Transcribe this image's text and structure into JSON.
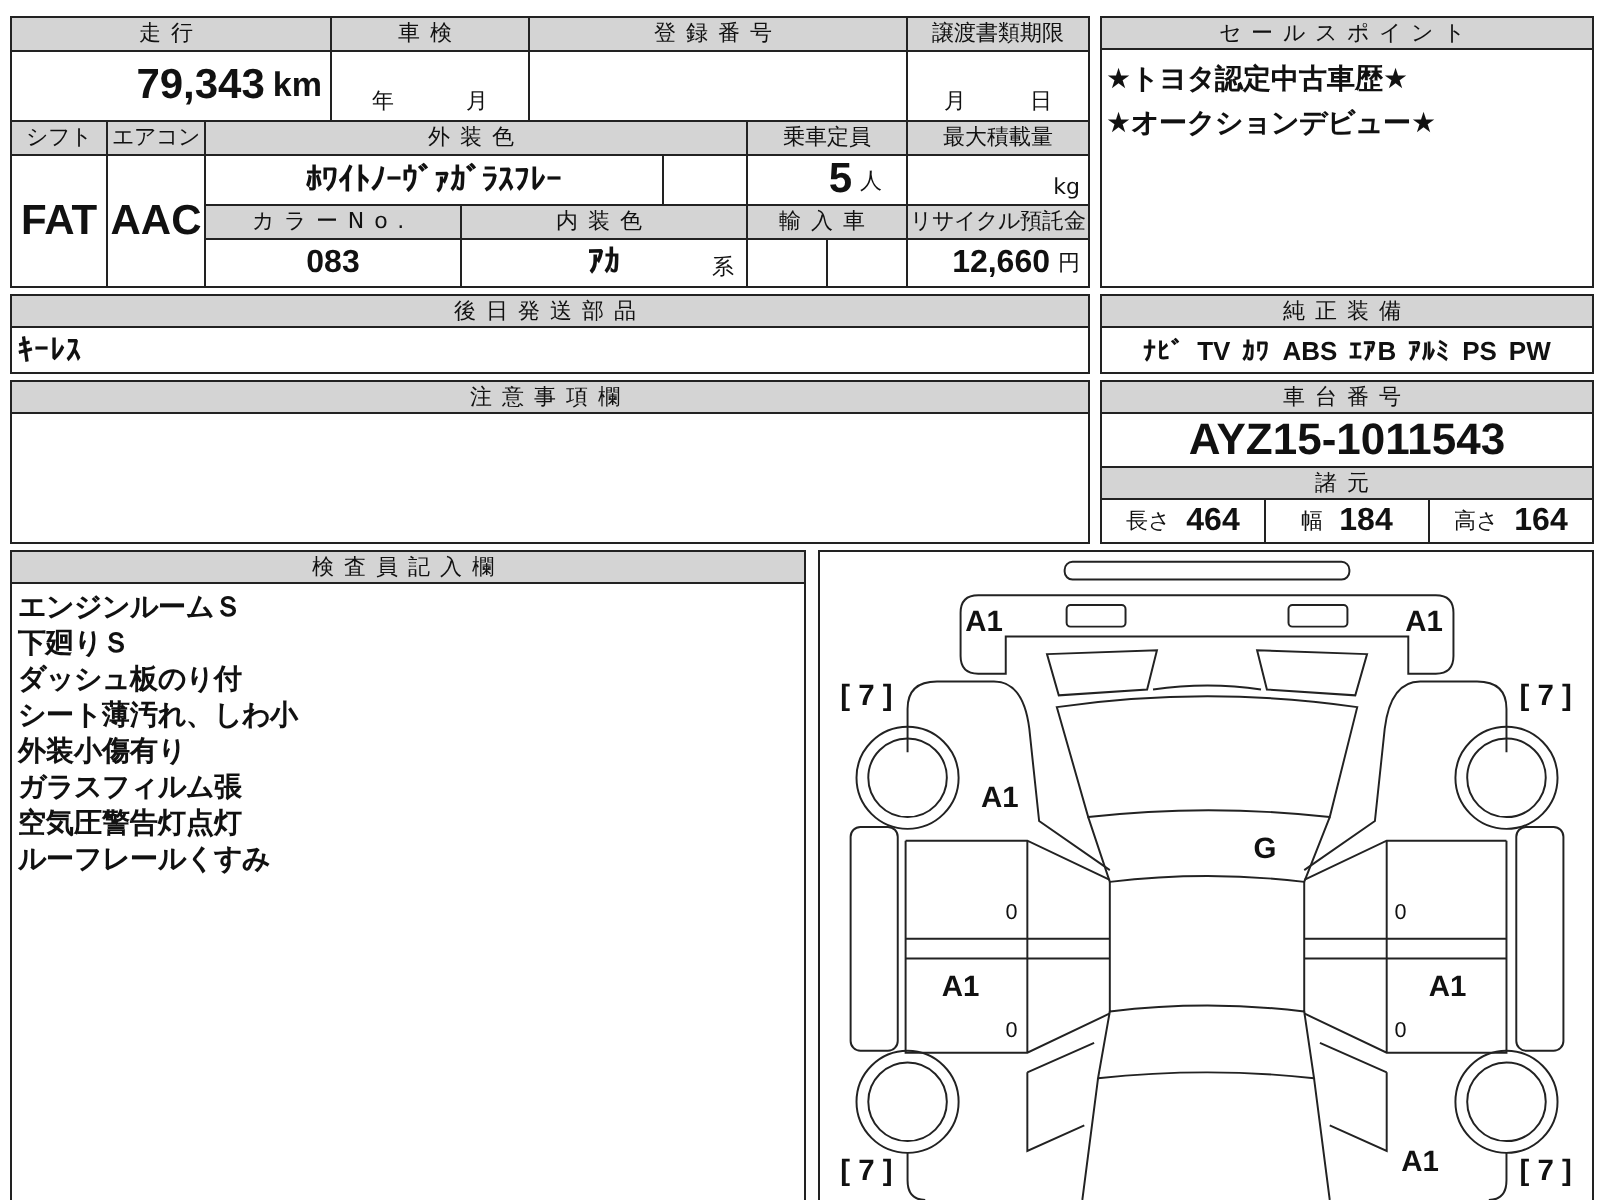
{
  "mileage": {
    "label": "走行",
    "value": "79,343",
    "unit": "km"
  },
  "inspection": {
    "label": "車検",
    "year_unit": "年",
    "month_unit": "月"
  },
  "registration_number": {
    "label": "登録番号"
  },
  "transfer_deadline": {
    "label": "譲渡書類期限",
    "month_unit": "月",
    "day_unit": "日"
  },
  "shift": {
    "label": "シフト",
    "value": "FAT"
  },
  "air_conditioner": {
    "label": "エアコン",
    "value": "AAC"
  },
  "exterior_color": {
    "label": "外装色",
    "value": "ﾎﾜｲﾄﾉｰｳﾞｧｶﾞﾗｽﾌﾚｰ"
  },
  "capacity": {
    "label": "乗車定員",
    "value": "5",
    "unit": "人"
  },
  "max_load": {
    "label": "最大積載量",
    "unit": "kg"
  },
  "color_number": {
    "label": "カラーNo.",
    "value": "083"
  },
  "interior_color": {
    "label": "内装色",
    "value": "ｱｶ",
    "suffix": "系"
  },
  "imported": {
    "label": "輸入車"
  },
  "recycle_deposit": {
    "label": "リサイクル預託金",
    "value": "12,660",
    "unit": "円"
  },
  "sales_points": {
    "label": "セールスポイント",
    "lines": [
      "★トヨタ認定中古車歴★",
      "★オークションデビュー★"
    ]
  },
  "later_shipped_parts": {
    "label": "後日発送部品",
    "value": "ｷｰﾚｽ"
  },
  "genuine_equipment": {
    "label": "純正装備",
    "items": [
      "ﾅﾋﾞ",
      "TV",
      "ｶﾜ",
      "ABS",
      "ｴｱB",
      "ｱﾙﾐ",
      "PS",
      "PW"
    ]
  },
  "notes": {
    "label": "注意事項欄"
  },
  "chassis_number": {
    "label": "車台番号",
    "value": "AYZ15-1011543"
  },
  "specs": {
    "label": "諸元",
    "items": [
      {
        "label": "長さ",
        "value": "464"
      },
      {
        "label": "幅",
        "value": "184"
      },
      {
        "label": "高さ",
        "value": "164"
      }
    ]
  },
  "inspector_notes": {
    "label": "検査員記入欄",
    "lines": [
      "エンジンルームＳ",
      "下廻りＳ",
      "ダッシュ板のり付",
      "シート薄汚れ、しわ小",
      "外装小傷有り",
      "ガラスフィルム張",
      "空気圧警告灯点灯",
      "ルーフレールくすみ"
    ]
  },
  "damage_diagram": {
    "marks": [
      {
        "text": "A1"
      },
      {
        "text": "A1"
      },
      {
        "text": "[ 7 ]"
      },
      {
        "text": "[ 7 ]"
      },
      {
        "text": "A1"
      },
      {
        "text": "G"
      },
      {
        "text": "0"
      },
      {
        "text": "0"
      },
      {
        "text": "A1"
      },
      {
        "text": "A1"
      },
      {
        "text": "0"
      },
      {
        "text": "0"
      },
      {
        "text": "[ 7 ]"
      },
      {
        "text": "A1"
      },
      {
        "text": "[ 7 ]"
      }
    ]
  }
}
